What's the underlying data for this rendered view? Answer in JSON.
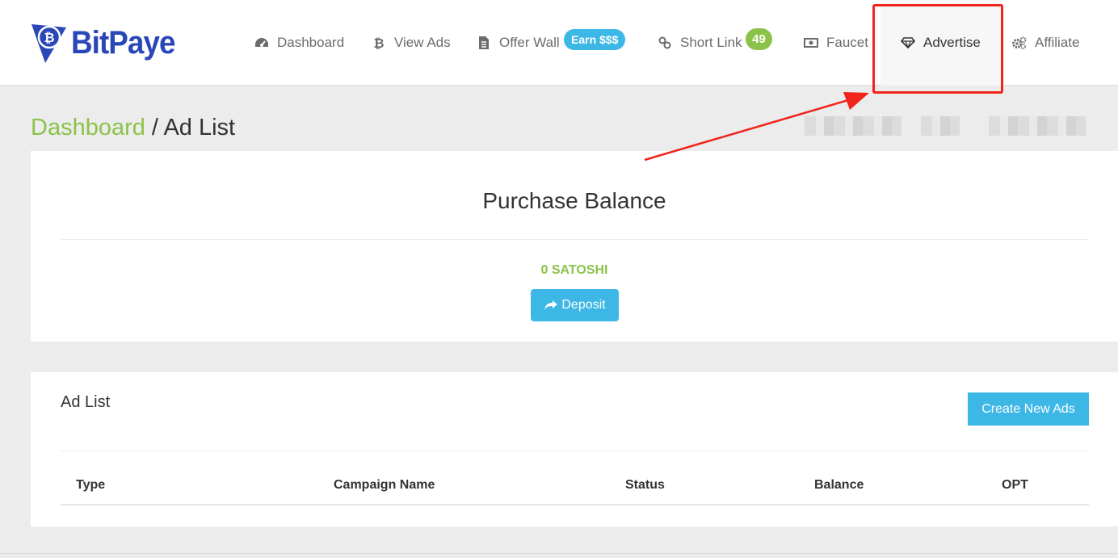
{
  "brand": {
    "name": "BitPaye",
    "logo_color": "#2a47b8"
  },
  "nav": {
    "items": [
      {
        "label": "Dashboard",
        "icon": "tachometer-icon"
      },
      {
        "label": "View Ads",
        "icon": "bitcoin-icon"
      },
      {
        "label": "Offer Wall",
        "icon": "file-icon",
        "badge": "Earn $$$"
      },
      {
        "label": "Short Link",
        "icon": "link-icon",
        "badge": "49"
      },
      {
        "label": "Faucet",
        "icon": "money-icon"
      },
      {
        "label": "Advertise",
        "icon": "diamond-icon",
        "active": true
      },
      {
        "label": "Affiliate",
        "icon": "gears-icon"
      }
    ]
  },
  "page": {
    "breadcrumb_link": "Dashboard",
    "breadcrumb_sep": " / ",
    "breadcrumb_current": "Ad List"
  },
  "balance": {
    "title": "Purchase Balance",
    "amount": "0 SATOSHI",
    "deposit_label": "Deposit"
  },
  "ad_list": {
    "title": "Ad List",
    "create_label": "Create New Ads",
    "columns": [
      "Type",
      "Campaign Name",
      "Status",
      "Balance",
      "OPT"
    ]
  },
  "colors": {
    "accent_blue": "#3db7e6",
    "accent_green": "#8bc34a",
    "annotation_red": "#f0241b"
  }
}
